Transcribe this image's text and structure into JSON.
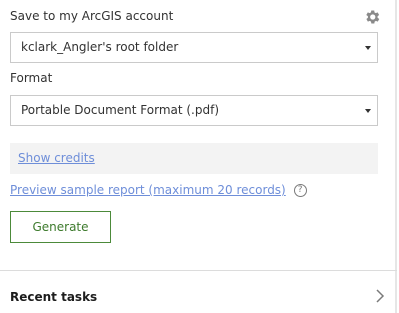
{
  "save": {
    "label": "Save to my ArcGIS account"
  },
  "folder": {
    "value": "kclark_Angler's root folder"
  },
  "format": {
    "label": "Format",
    "value": "Portable Document Format (.pdf)"
  },
  "credits": {
    "link": "Show credits"
  },
  "preview": {
    "link": "Preview sample report (maximum 20 records)",
    "help_glyph": "?"
  },
  "generate": {
    "label": "Generate"
  },
  "recent": {
    "label": "Recent tasks"
  },
  "colors": {
    "link": "#6e8ed9",
    "accent_green": "#4c8a3a"
  },
  "icons": {
    "settings": "gear-icon",
    "help": "help-icon",
    "expand": "chevron-right-icon"
  }
}
